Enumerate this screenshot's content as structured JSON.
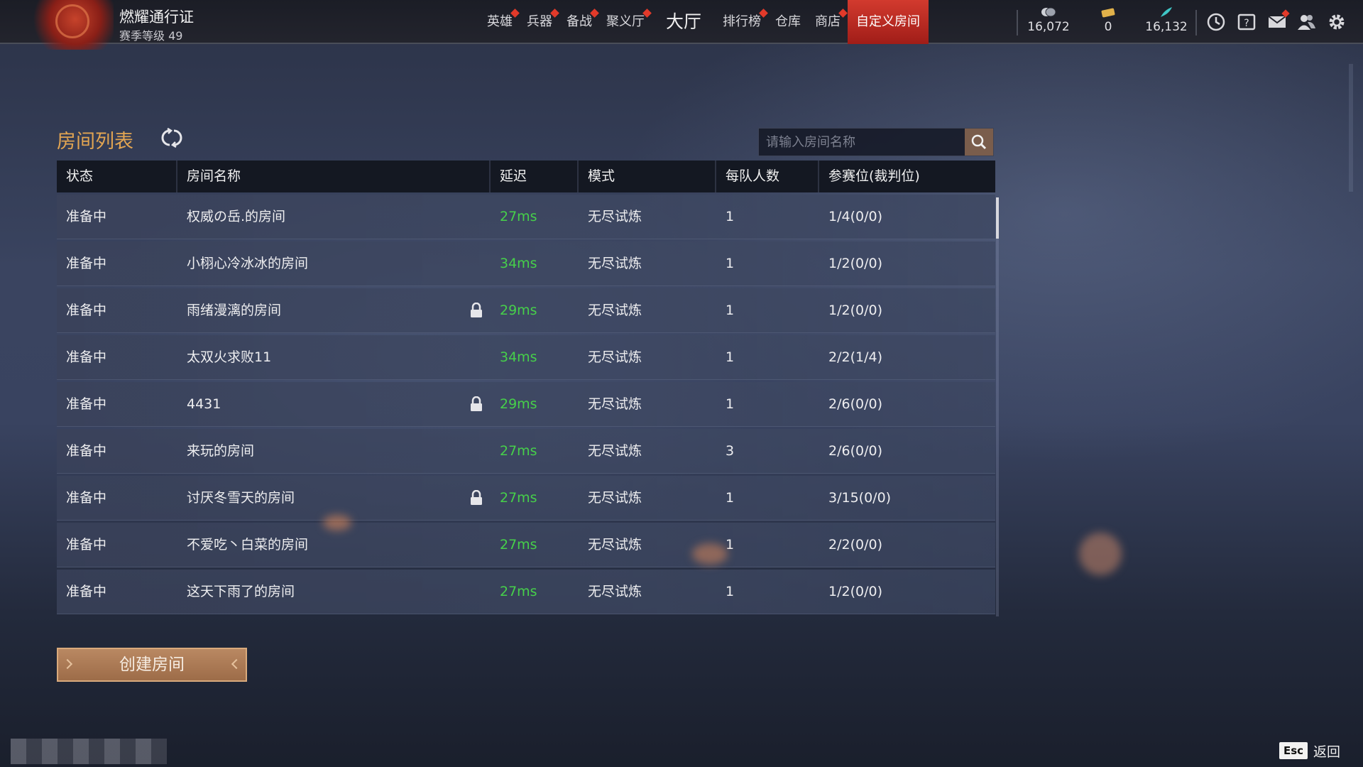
{
  "topbar": {
    "pass_title": "燃耀通行证",
    "pass_level": "赛季等级 49",
    "nav": [
      {
        "label": "英雄",
        "badge": true
      },
      {
        "label": "兵器",
        "badge": true
      },
      {
        "label": "备战",
        "badge": true
      },
      {
        "label": "聚义厅",
        "badge": true
      },
      {
        "label": "大厅",
        "badge": false
      },
      {
        "label": "排行榜",
        "badge": true
      },
      {
        "label": "仓库",
        "badge": false
      },
      {
        "label": "商店",
        "badge": true
      },
      {
        "label": "自定义房间",
        "badge": false,
        "active": true
      }
    ],
    "currencies": [
      {
        "icon": "coin-icon",
        "value": "16,072"
      },
      {
        "icon": "ticket-icon",
        "value": "0"
      },
      {
        "icon": "feather-icon",
        "value": "16,132"
      }
    ],
    "tools": [
      "clock-icon",
      "help-book-icon",
      "mail-icon",
      "friends-icon",
      "settings-icon"
    ]
  },
  "room_list": {
    "title": "房间列表",
    "search_placeholder": "请输入房间名称",
    "columns": [
      "状态",
      "房间名称",
      "延迟",
      "模式",
      "每队人数",
      "参赛位(裁判位)"
    ],
    "rows": [
      {
        "status": "准备中",
        "name": "权威の岳.的房间",
        "locked": false,
        "latency": "27ms",
        "mode": "无尽试炼",
        "team_size": "1",
        "slots": "1/4(0/0)"
      },
      {
        "status": "准备中",
        "name": "小栩心冷冰冰的房间",
        "locked": false,
        "latency": "34ms",
        "mode": "无尽试炼",
        "team_size": "1",
        "slots": "1/2(0/0)"
      },
      {
        "status": "准备中",
        "name": "雨绪漫漓的房间",
        "locked": true,
        "latency": "29ms",
        "mode": "无尽试炼",
        "team_size": "1",
        "slots": "1/2(0/0)"
      },
      {
        "status": "准备中",
        "name": "太双火求败11",
        "locked": false,
        "latency": "34ms",
        "mode": "无尽试炼",
        "team_size": "1",
        "slots": "2/2(1/4)"
      },
      {
        "status": "准备中",
        "name": "4431",
        "locked": true,
        "latency": "29ms",
        "mode": "无尽试炼",
        "team_size": "1",
        "slots": "2/6(0/0)"
      },
      {
        "status": "准备中",
        "name": "来玩的房间",
        "locked": false,
        "latency": "27ms",
        "mode": "无尽试炼",
        "team_size": "3",
        "slots": "2/6(0/0)"
      },
      {
        "status": "准备中",
        "name": "讨厌冬雪天的房间",
        "locked": true,
        "latency": "27ms",
        "mode": "无尽试炼",
        "team_size": "1",
        "slots": "3/15(0/0)"
      },
      {
        "status": "准备中",
        "name": "不爱吃丶白菜的房间",
        "locked": false,
        "latency": "27ms",
        "mode": "无尽试炼",
        "team_size": "1",
        "slots": "2/2(0/0)"
      },
      {
        "status": "准备中",
        "name": "这天下雨了的房间",
        "locked": false,
        "latency": "27ms",
        "mode": "无尽试炼",
        "team_size": "1",
        "slots": "1/2(0/0)"
      }
    ]
  },
  "create_button": "创建房间",
  "footer": {
    "esc_key": "Esc",
    "back_label": "返回"
  },
  "colors": {
    "accent_title": "#e2a552",
    "latency_green": "#46d04a",
    "active_tab": "#c62f25",
    "button": "#a8764f"
  }
}
